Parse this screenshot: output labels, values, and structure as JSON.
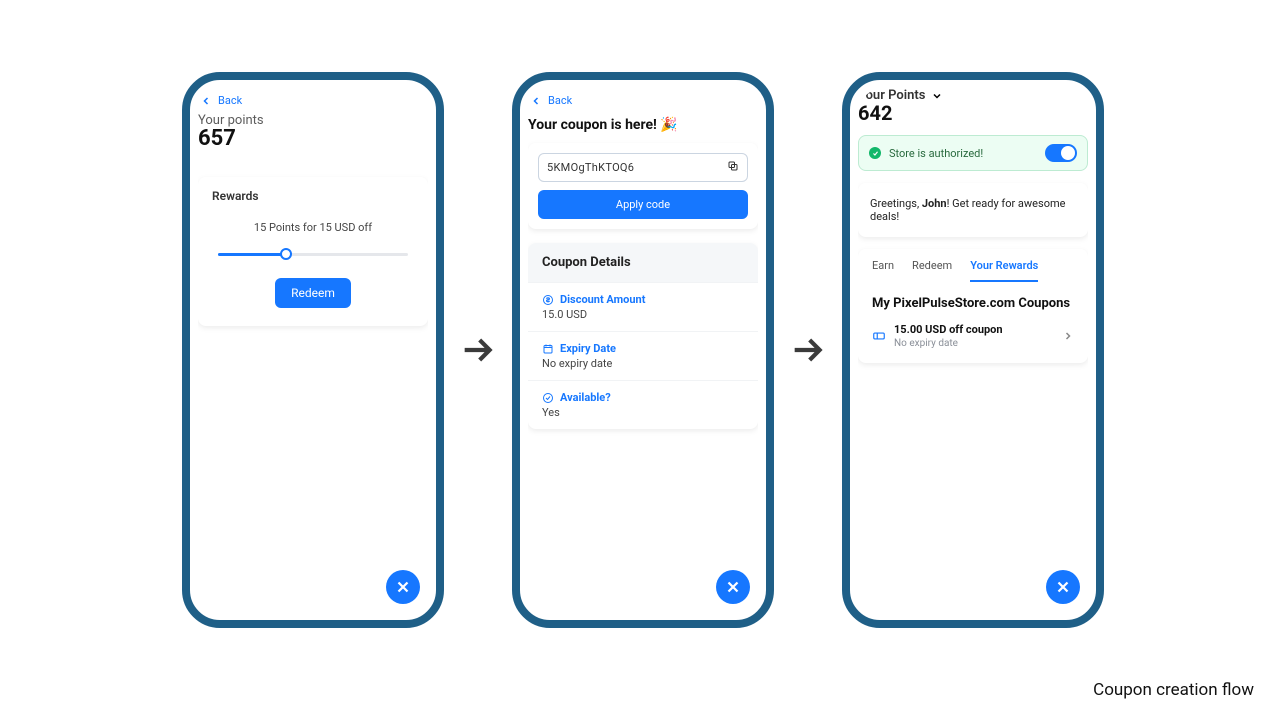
{
  "caption": "Coupon creation flow",
  "back_label": "Back",
  "phone1": {
    "points_label": "Your points",
    "points_value": "657",
    "rewards_title": "Rewards",
    "rate_line": "15 Points for 15 USD off",
    "redeem_label": "Redeem"
  },
  "phone2": {
    "title": "Your coupon is here! 🎉",
    "code": "5KMOgThKTOQ6",
    "apply_label": "Apply code",
    "details_header": "Coupon Details",
    "rows": [
      {
        "k": "Discount Amount",
        "v": "15.0 USD"
      },
      {
        "k": "Expiry Date",
        "v": "No expiry date"
      },
      {
        "k": "Available?",
        "v": "Yes"
      }
    ]
  },
  "phone3": {
    "points_label": "Your Points",
    "points_value": "642",
    "auth_text": "Store is authorized!",
    "greeting_pre": "Greetings, ",
    "greeting_name": "John",
    "greeting_post": "! Get ready for awesome deals!",
    "tabs": {
      "earn": "Earn",
      "redeem": "Redeem",
      "rewards": "Your Rewards"
    },
    "section_title": "My PixelPulseStore.com Coupons",
    "coupon": {
      "title": "15.00 USD off coupon",
      "sub": "No expiry date"
    }
  }
}
